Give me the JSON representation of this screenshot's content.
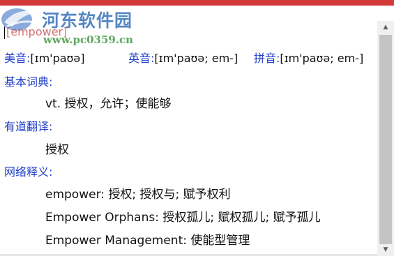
{
  "watermark": {
    "title": "河东软件园",
    "url": "www.pc0359.cn"
  },
  "entry": {
    "word": "[empower]"
  },
  "phonetics": {
    "us_label": "美音:",
    "us_value": "[ɪm'paʊə]",
    "uk_label": "英音:",
    "uk_value": "[ɪm'paʊə; em-]",
    "pinyin_label": "拼音:",
    "pinyin_value": "[ɪm'paʊə; em-]"
  },
  "sections": {
    "basic": {
      "title": "基本词典:",
      "items": [
        "vt. 授权，允许；使能够"
      ]
    },
    "youdao": {
      "title": "有道翻译:",
      "items": [
        "授权"
      ]
    },
    "web": {
      "title": "网络释义:",
      "items": [
        "empower: 授权; 授权与; 赋予权利",
        "Empower Orphans: 授权孤儿; 赋权孤儿; 赋予孤儿",
        "Empower Management: 使能型管理"
      ]
    }
  },
  "scrollbar": {
    "up_icon": "▲",
    "down_icon": "▼"
  },
  "colors": {
    "accent": "#d23a3a",
    "label_blue": "#1f3ec8",
    "watermark_blue": "#1d5fb0",
    "watermark_green": "#2a8a2a"
  }
}
